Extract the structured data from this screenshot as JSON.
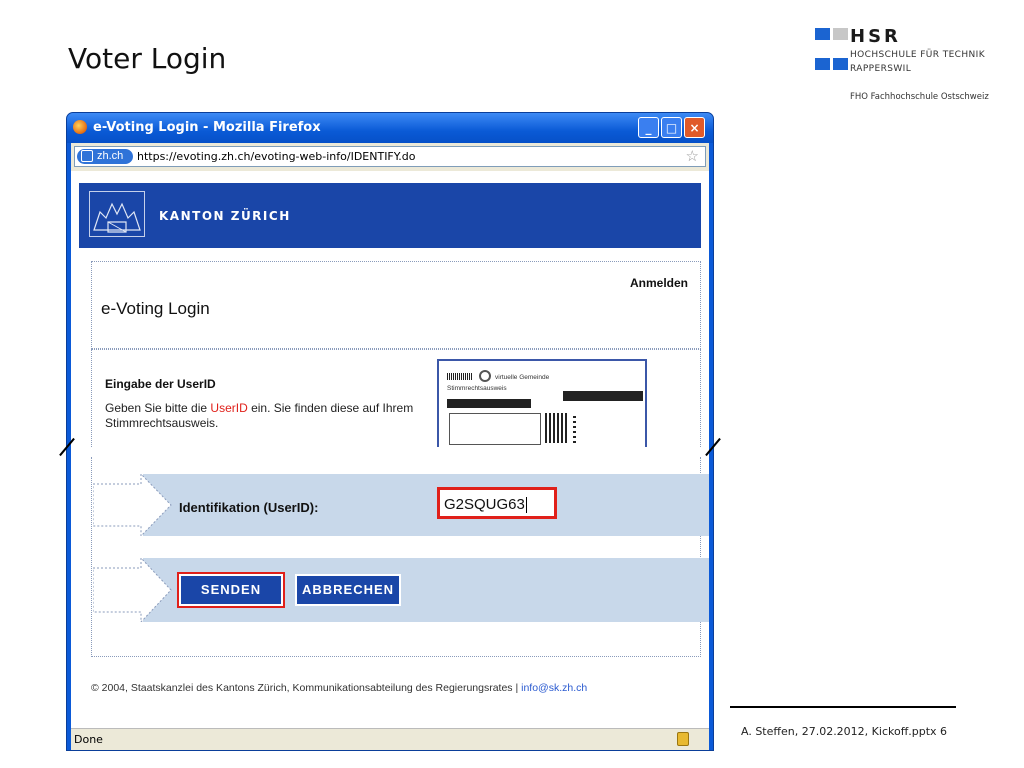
{
  "slide": {
    "title": "Voter Login",
    "logo": {
      "name": "HSR",
      "line1": "HOCHSCHULE FÜR TECHNIK",
      "line2": "RAPPERSWIL",
      "line3": "FHO Fachhochschule Ostschweiz"
    },
    "credit": "A. Steffen, 27.02.2012, Kickoff.pptx 6"
  },
  "browser": {
    "window_title": "e-Voting Login - Mozilla Firefox",
    "site_identity": "zh.ch",
    "url": "https://evoting.zh.ch/evoting-web-info/IDENTIFY.do",
    "status": "Done"
  },
  "page": {
    "banner_text": "KANTON ZÜRICH",
    "anmelden": "Anmelden",
    "heading": "e-Voting Login",
    "section_title": "Eingabe der UserID",
    "desc_pre": "Geben Sie bitte die ",
    "desc_highlight": "UserID",
    "desc_post": " ein. Sie finden diese auf Ihrem Stimmrechtsausweis.",
    "ticket": {
      "community": "virtuelle Gemeinde",
      "doc": "Stimmrechtsausweis"
    },
    "id_label": "Identifikation (UserID):",
    "id_value": "G2SQUG63",
    "send_label": "SENDEN",
    "cancel_label": "ABBRECHEN",
    "footer_text": "© 2004, Staatskanzlei des Kantons Zürich, Kommunikationsabteilung des Regierungsrates | ",
    "footer_email": "info@sk.zh.ch"
  }
}
